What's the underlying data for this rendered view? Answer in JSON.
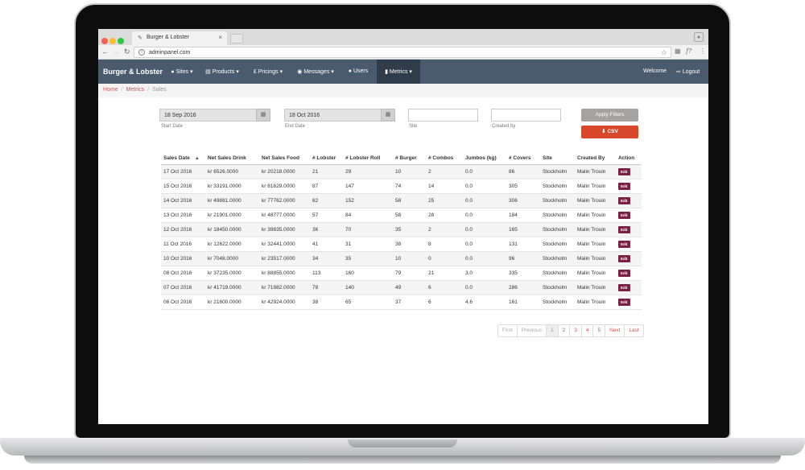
{
  "browser": {
    "tab_title": "Burger & Lobster",
    "url": "adminpanel.com"
  },
  "navbar": {
    "brand": "Burger & Lobster",
    "items": [
      {
        "label": "Sites",
        "icon": "map-marker-icon"
      },
      {
        "label": "Products",
        "icon": "cart-icon"
      },
      {
        "label": "Pricings",
        "icon": "pound-icon"
      },
      {
        "label": "Messages",
        "icon": "comment-icon"
      },
      {
        "label": "Users",
        "icon": "users-icon"
      },
      {
        "label": "Metrics",
        "icon": "bar-chart-icon"
      }
    ],
    "welcome": "Welcome",
    "logout": "Logout"
  },
  "breadcrumb": {
    "home": "Home",
    "metrics": "Metrics",
    "current": "Sales"
  },
  "filters": {
    "start_date_value": "18 Sep 2016",
    "start_date_label": "Start Date",
    "end_date_value": "18 Oct 2016",
    "end_date_label": "End Date",
    "site_label": "Site",
    "created_by_label": "Created by",
    "apply_label": "Apply Filters",
    "csv_label": "CSV"
  },
  "table": {
    "columns": [
      "Sales Date",
      "Net Sales Drink",
      "Net Sales Food",
      "# Lobster",
      "# Lobster Roll",
      "# Burger",
      "# Combos",
      "Jumbos (kg)",
      "# Covers",
      "Site",
      "Created By",
      "Action"
    ],
    "edit_label": "Edit",
    "rows": [
      [
        "17 Oct 2016",
        "kr 6526.0000",
        "kr 20218.0000",
        "21",
        "29",
        "10",
        "2",
        "0.0",
        "86",
        "Stockholm",
        "Malin Trouin"
      ],
      [
        "15 Oct 2016",
        "kr 33191.0000",
        "kr 81629.0000",
        "87",
        "147",
        "74",
        "14",
        "0.0",
        "305",
        "Stockholm",
        "Malin Trouin"
      ],
      [
        "14 Oct 2016",
        "kr 49881.0000",
        "kr 77762.0000",
        "82",
        "152",
        "58",
        "25",
        "0.0",
        "306",
        "Stockholm",
        "Malin Trouin"
      ],
      [
        "13 Oct 2016",
        "kr 21901.0000",
        "kr 48777.0000",
        "57",
        "84",
        "58",
        "28",
        "0.0",
        "184",
        "Stockholm",
        "Malin Trouin"
      ],
      [
        "12 Oct 2016",
        "kr 18450.0000",
        "kr 39835.0000",
        "36",
        "70",
        "35",
        "2",
        "0.0",
        "165",
        "Stockholm",
        "Malin Trouin"
      ],
      [
        "11 Oct 2016",
        "kr 12622.0000",
        "kr 32441.0000",
        "41",
        "31",
        "38",
        "8",
        "0.0",
        "131",
        "Stockholm",
        "Malin Trouin"
      ],
      [
        "10 Oct 2016",
        "kr 7048.0000",
        "kr 23517.0000",
        "34",
        "35",
        "10",
        "0",
        "0.0",
        "96",
        "Stockholm",
        "Malin Trouin"
      ],
      [
        "08 Oct 2016",
        "kr 37235.0000",
        "kr 88855.0000",
        "113",
        "160",
        "79",
        "21",
        "3.0",
        "335",
        "Stockholm",
        "Malin Trouin"
      ],
      [
        "07 Oct 2016",
        "kr 41719.0000",
        "kr 71982.0000",
        "78",
        "140",
        "49",
        "6",
        "0.0",
        "286",
        "Stockholm",
        "Malin Trouin"
      ],
      [
        "06 Oct 2016",
        "kr 21600.0000",
        "kr 42924.0000",
        "38",
        "65",
        "37",
        "6",
        "4.6",
        "161",
        "Stockholm",
        "Malin Trouin"
      ]
    ]
  },
  "pagination": {
    "first": "First",
    "previous": "Previous",
    "pages": [
      "1",
      "2",
      "3",
      "4",
      "5"
    ],
    "current": "1",
    "next": "Next",
    "last": "Last"
  },
  "colors": {
    "navbar": "#4a5b6e",
    "navbar_active": "#2f3c4b",
    "link_red": "#d9534f",
    "csv_button": "#d9472b",
    "edit_button": "#7a2040",
    "apply_button": "#a5a29f"
  }
}
